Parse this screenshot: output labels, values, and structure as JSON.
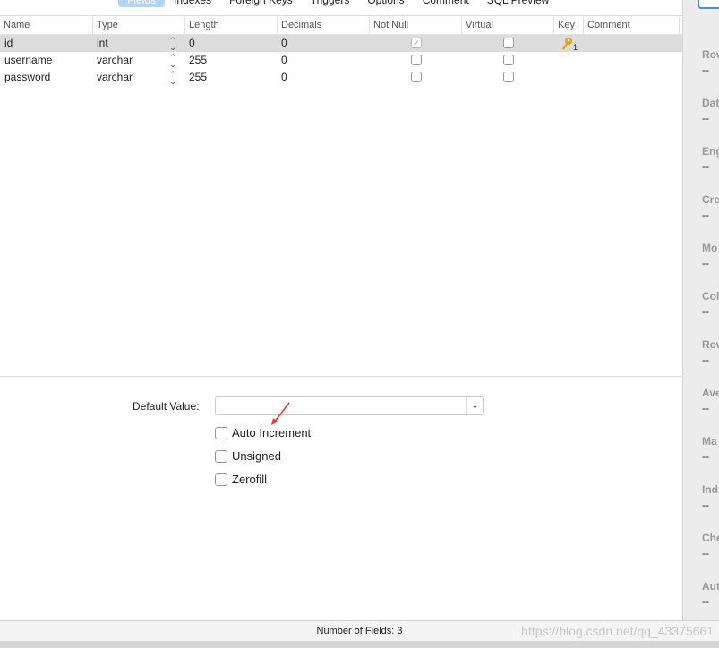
{
  "tabs": [
    {
      "label": "Fields",
      "selected": true
    },
    {
      "label": "Indexes"
    },
    {
      "label": "Foreign Keys"
    },
    {
      "label": "Triggers"
    },
    {
      "label": "Options"
    },
    {
      "label": "Comment"
    },
    {
      "label": "SQL Preview"
    }
  ],
  "columns": [
    "Name",
    "Type",
    "Length",
    "Decimals",
    "Not Null",
    "Virtual",
    "Key",
    "Comment"
  ],
  "rows": [
    {
      "name": "id",
      "type": "int",
      "length": "0",
      "decimals": "0",
      "not_null": true,
      "virtual": false,
      "key": "1",
      "selected": true
    },
    {
      "name": "username",
      "type": "varchar",
      "length": "255",
      "decimals": "0",
      "not_null": false,
      "virtual": false,
      "key": ""
    },
    {
      "name": "password",
      "type": "varchar",
      "length": "255",
      "decimals": "0",
      "not_null": false,
      "virtual": false,
      "key": ""
    }
  ],
  "icons": {
    "key": "key-icon",
    "stepper": "updown-chevron-icon",
    "dropdown": "chevron-down-icon"
  },
  "default_value": {
    "label": "Default Value:",
    "value": ""
  },
  "options": [
    {
      "label": "Auto Increment",
      "checked": false
    },
    {
      "label": "Unsigned",
      "checked": false
    },
    {
      "label": "Zerofill",
      "checked": false
    }
  ],
  "sidebar": [
    {
      "label": "Row",
      "value": "--"
    },
    {
      "label": "Dat",
      "value": "--"
    },
    {
      "label": "Eng",
      "value": "--"
    },
    {
      "label": "Cre",
      "value": "--"
    },
    {
      "label": "Mo",
      "value": "--"
    },
    {
      "label": "Col",
      "value": "--"
    },
    {
      "label": "Row",
      "value": "--"
    },
    {
      "label": "Ave",
      "value": "--"
    },
    {
      "label": "Ma",
      "value": "--"
    },
    {
      "label": "Ind",
      "value": "--"
    },
    {
      "label": "Che",
      "value": "--"
    },
    {
      "label": "Aut",
      "value": "--"
    }
  ],
  "status": {
    "text": "Number of Fields: 3"
  },
  "watermark": "https://blog.csdn.net/qq_43375661",
  "colors": {
    "selected_tab": "#b3d3fb",
    "selected_row": "#dcdcdc",
    "key": "#e8a317",
    "annotation_arrow": "#ff2a2a"
  }
}
